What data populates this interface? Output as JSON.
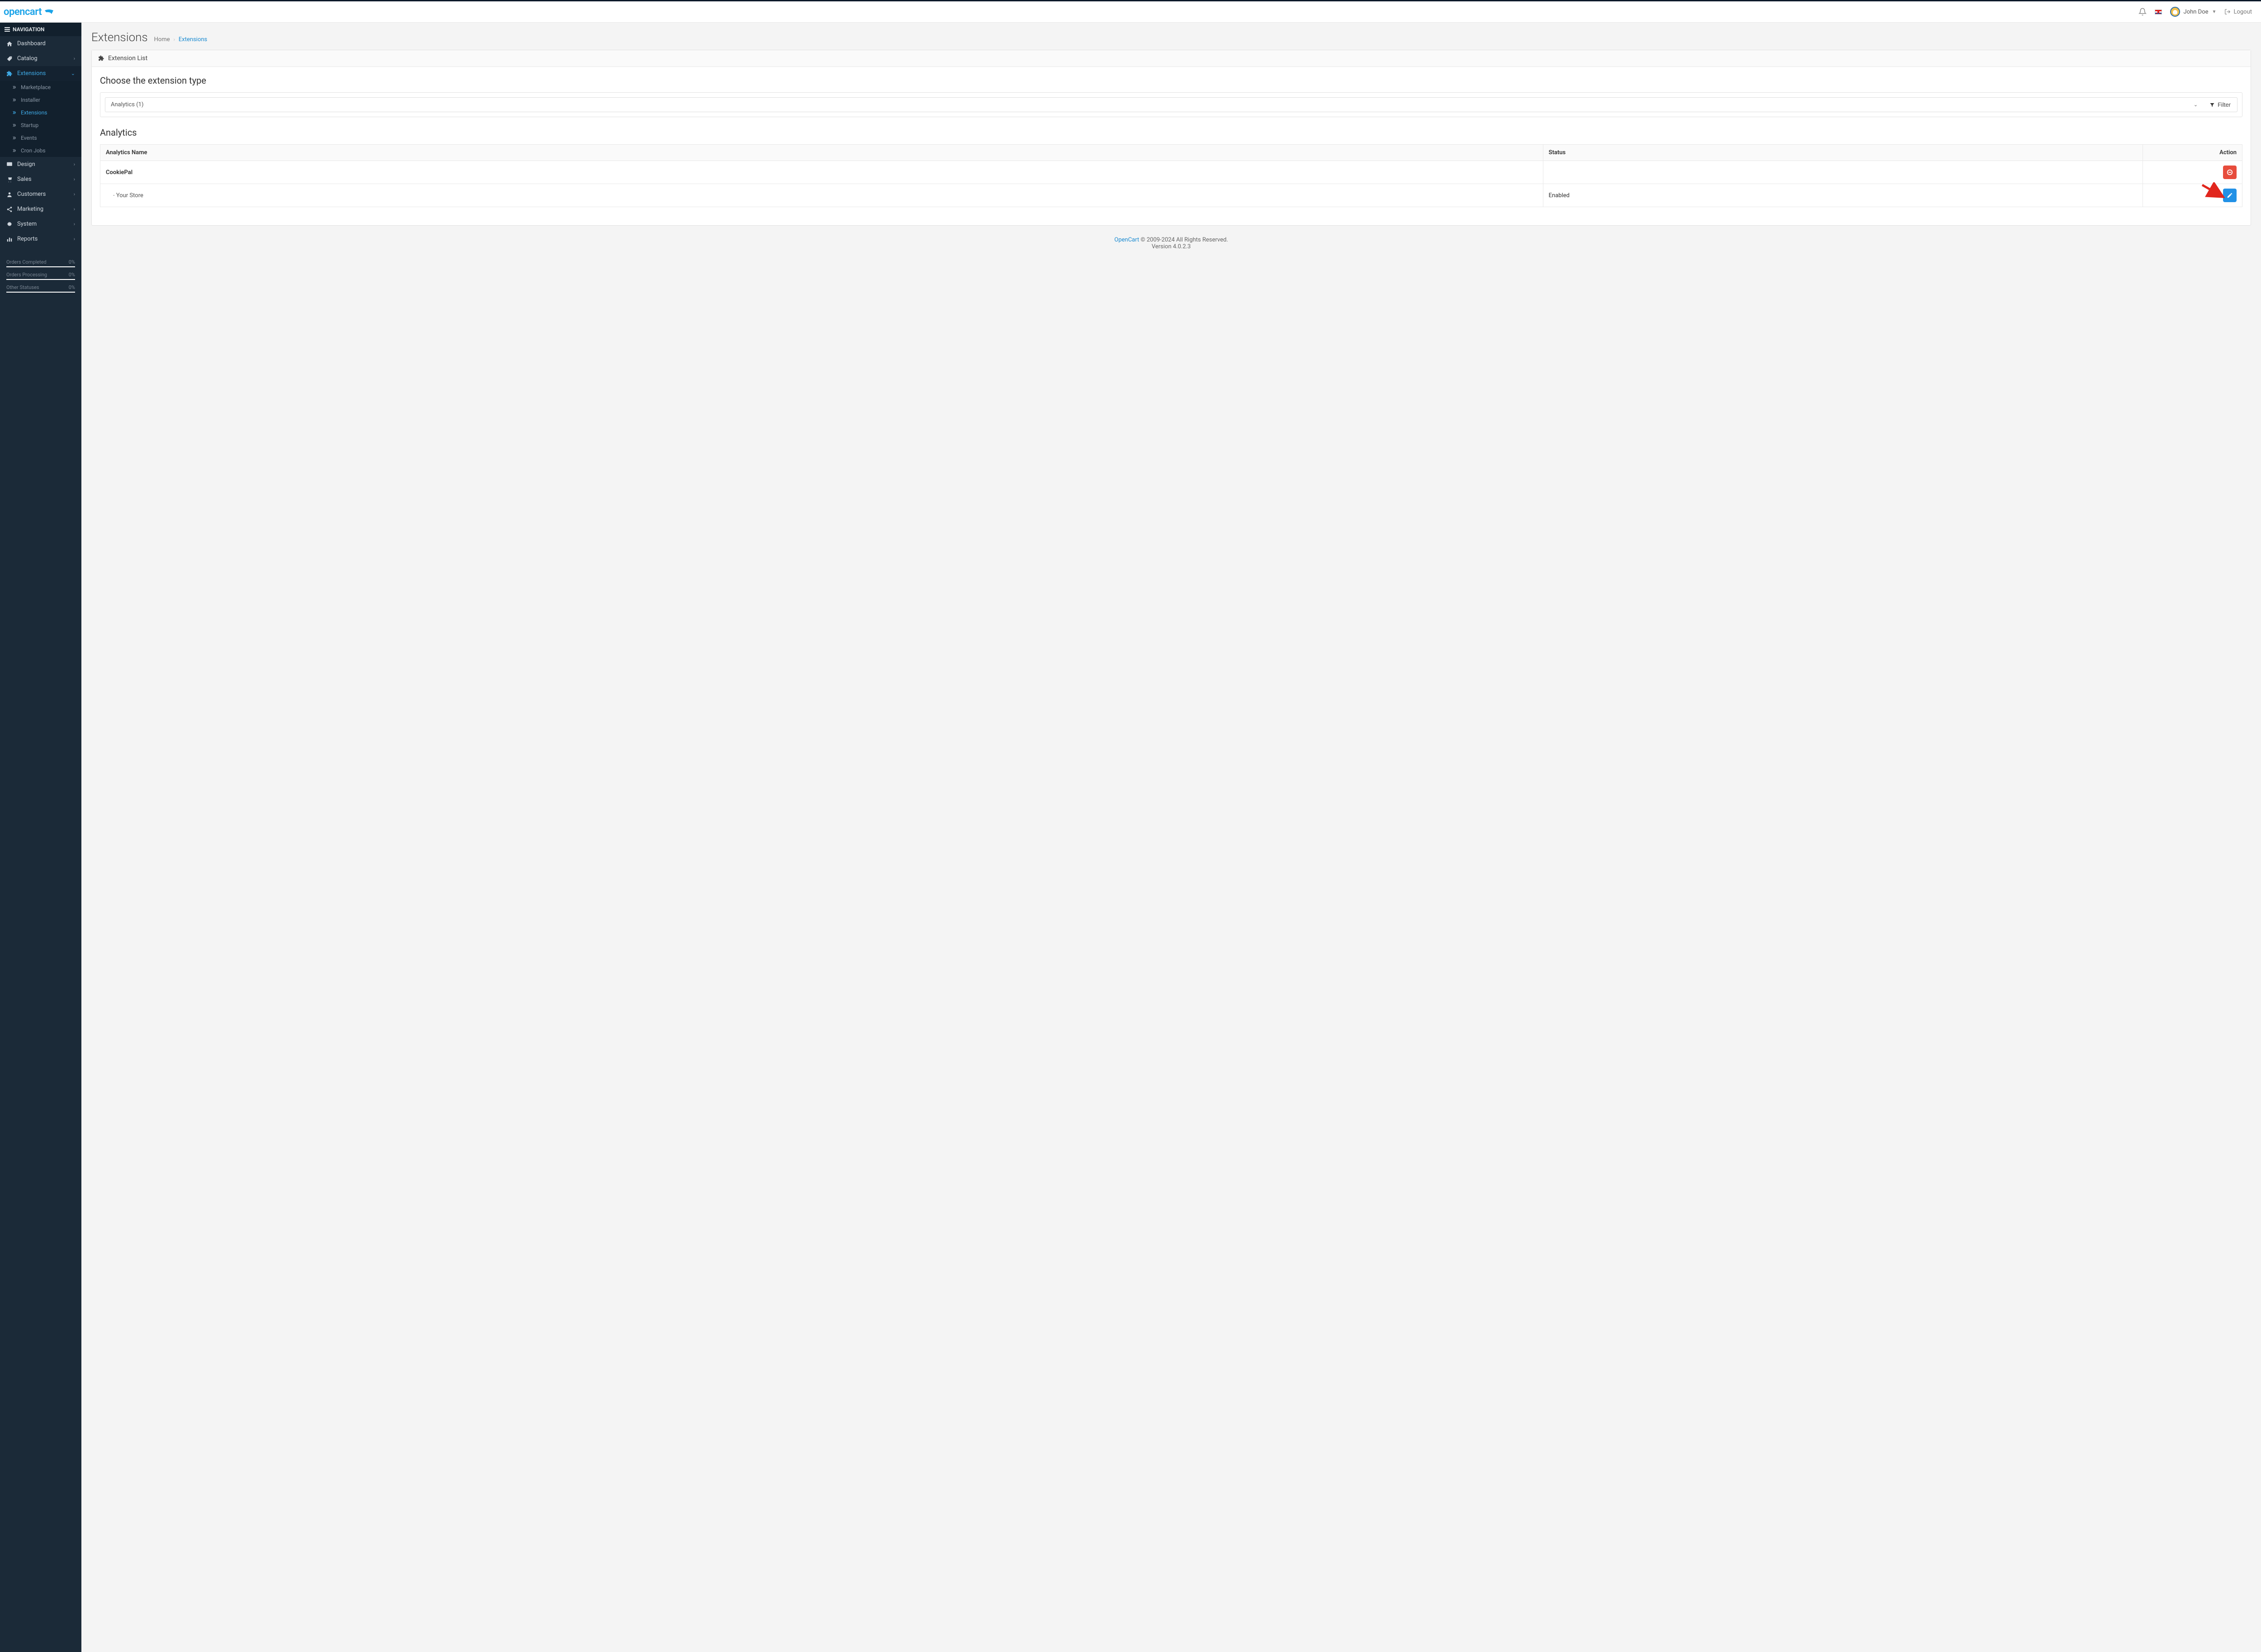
{
  "header": {
    "brand": "opencart",
    "user_name": "John Doe",
    "logout_label": "Logout"
  },
  "sidebar": {
    "nav_label": "NAVIGATION",
    "items": [
      {
        "label": "Dashboard"
      },
      {
        "label": "Catalog"
      },
      {
        "label": "Extensions"
      },
      {
        "label": "Design"
      },
      {
        "label": "Sales"
      },
      {
        "label": "Customers"
      },
      {
        "label": "Marketing"
      },
      {
        "label": "System"
      },
      {
        "label": "Reports"
      }
    ],
    "ext_sub": [
      {
        "label": "Marketplace"
      },
      {
        "label": "Installer"
      },
      {
        "label": "Extensions"
      },
      {
        "label": "Startup"
      },
      {
        "label": "Events"
      },
      {
        "label": "Cron Jobs"
      }
    ],
    "stats": [
      {
        "label": "Orders Completed",
        "value": "0%"
      },
      {
        "label": "Orders Processing",
        "value": "0%"
      },
      {
        "label": "Other Statuses",
        "value": "0%"
      }
    ]
  },
  "page": {
    "title": "Extensions",
    "crumb_home": "Home",
    "crumb_current": "Extensions",
    "panel_title": "Extension List",
    "type_heading": "Choose the extension type",
    "type_selected": "Analytics (1)",
    "filter_label": "Filter",
    "section_heading": "Analytics",
    "table": {
      "col_name": "Analytics Name",
      "col_status": "Status",
      "col_action": "Action",
      "rows": [
        {
          "name": "CookiePal",
          "status": ""
        },
        {
          "name": "Your Store",
          "status": "Enabled"
        }
      ]
    }
  },
  "footer": {
    "link": "OpenCart",
    "rights": " © 2009-2024 All Rights Reserved.",
    "version": "Version 4.0.2.3"
  }
}
